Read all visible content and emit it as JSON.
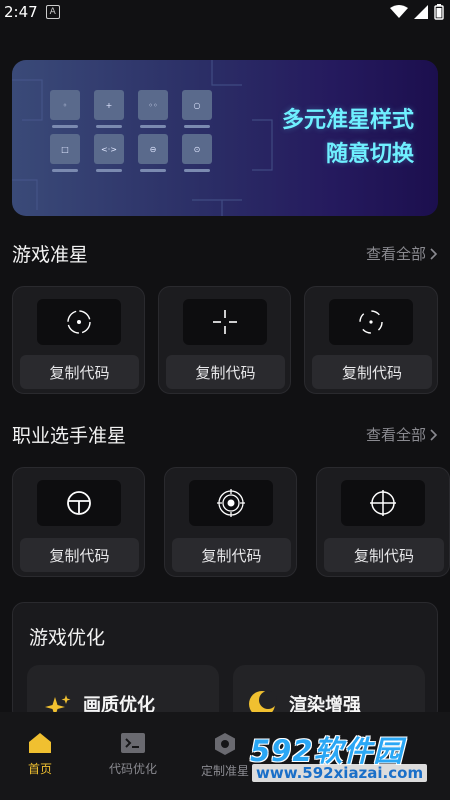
{
  "status_bar": {
    "time": "2:47",
    "notif": "A"
  },
  "banner": {
    "title_line1": "多元准星样式",
    "title_line2": "随意切换",
    "thumbnails": [
      "◦",
      "+",
      "◦◦",
      "○",
      "□",
      "<·>",
      "⊖",
      "⊙"
    ]
  },
  "sections": [
    {
      "title": "游戏准星",
      "see_all": "查看全部",
      "cards": [
        {
          "icon": "dot-circle-crosshair-icon",
          "button": "复制代码"
        },
        {
          "icon": "split-cross-crosshair-icon",
          "button": "复制代码"
        },
        {
          "icon": "bracket-circle-crosshair-icon",
          "button": "复制代码"
        }
      ]
    },
    {
      "title": "职业选手准星",
      "see_all": "查看全部",
      "cards": [
        {
          "icon": "wheel-crosshair-icon",
          "button": "复制代码"
        },
        {
          "icon": "target-rings-crosshair-icon",
          "button": "复制代码"
        },
        {
          "icon": "scope-crosshair-icon",
          "button": "复制代码"
        }
      ]
    }
  ],
  "optimization": {
    "title": "游戏优化",
    "items": [
      {
        "label": "画质优化",
        "icon": "sparkle-icon"
      },
      {
        "label": "渲染增强",
        "icon": "moon-icon"
      }
    ]
  },
  "nav": [
    {
      "label": "首页",
      "icon": "home-icon",
      "active": true
    },
    {
      "label": "代码优化",
      "icon": "terminal-icon",
      "active": false
    },
    {
      "label": "定制准星",
      "icon": "hexagon-icon",
      "active": false
    }
  ],
  "watermark": {
    "main": "592软件园",
    "url": "www.592xiazai.com"
  },
  "colors": {
    "accent": "#f0c030",
    "banner_text": "#6ff0ff",
    "watermark": "#2aa7f5"
  }
}
